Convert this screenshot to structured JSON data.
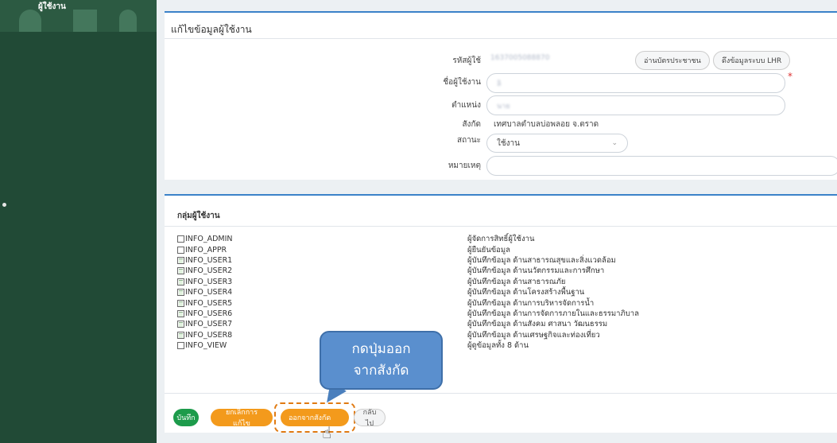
{
  "sidebar": {
    "title": "ผู้ใช้งาน"
  },
  "edit_panel": {
    "title": "แก้ไขข้อมูลผู้ใช้งาน",
    "user_code": {
      "label": "รหัสผู้ใช้",
      "value": "1637005088870"
    },
    "buttons": {
      "read_id_card": "อ่านบัตรประชาชน",
      "fetch_lhr": "ดึงข้อมูลระบบ LHR"
    },
    "username": {
      "label": "ชื่อผู้ใช้งาน",
      "value": "ลิ"
    },
    "position": {
      "label": "ตำแหน่ง",
      "value": "นาย"
    },
    "affiliation": {
      "label": "สังกัด",
      "value": "เทศบาลตำบลบ่อพลอย จ.ตราด"
    },
    "status": {
      "label": "สถานะ",
      "value": "ใช้งาน"
    },
    "note": {
      "label": "หมายเหตุ",
      "value": ""
    }
  },
  "group_panel": {
    "title": "กลุ่มผู้ใช้งาน",
    "groups": [
      {
        "code": "INFO_ADMIN",
        "desc": "ผู้จัดการสิทธิ์ผู้ใช้งาน",
        "checked": false
      },
      {
        "code": "INFO_APPR",
        "desc": "ผู้ยืนยันข้อมูล",
        "checked": false
      },
      {
        "code": "INFO_USER1",
        "desc": "ผู้บันทึกข้อมูล ด้านสาธารณสุขและสิ่งแวดล้อม",
        "checked": true
      },
      {
        "code": "INFO_USER2",
        "desc": "ผู้บันทึกข้อมูล ด้านนวัตกรรมและการศึกษา",
        "checked": true
      },
      {
        "code": "INFO_USER3",
        "desc": "ผู้บันทึกข้อมูล ด้านสาธารณภัย",
        "checked": true
      },
      {
        "code": "INFO_USER4",
        "desc": "ผู้บันทึกข้อมูล ด้านโครงสร้างพื้นฐาน",
        "checked": true
      },
      {
        "code": "INFO_USER5",
        "desc": "ผู้บันทึกข้อมูล ด้านการบริหารจัดการน้ำ",
        "checked": true
      },
      {
        "code": "INFO_USER6",
        "desc": "ผู้บันทึกข้อมูล ด้านการจัดการภายในและธรรมาภิบาล",
        "checked": true
      },
      {
        "code": "INFO_USER7",
        "desc": "ผู้บันทึกข้อมูล ด้านสังคม ศาสนา วัฒนธรรม",
        "checked": true
      },
      {
        "code": "INFO_USER8",
        "desc": "ผู้บันทึกข้อมูล ด้านเศรษฐกิจและท่องเที่ยว",
        "checked": true
      },
      {
        "code": "INFO_VIEW",
        "desc": "ผู้ดูข้อมูลทั้ง 8 ด้าน",
        "checked": false
      }
    ]
  },
  "actions": {
    "save": "บันทึก",
    "cancel": "ยกเลิกการแก้ไข",
    "leave_affiliation": "ออกจากสังกัด",
    "back": "กลับไป"
  },
  "callout": {
    "line1": "กดปุ่มออก",
    "line2": "จากสังกัด"
  }
}
